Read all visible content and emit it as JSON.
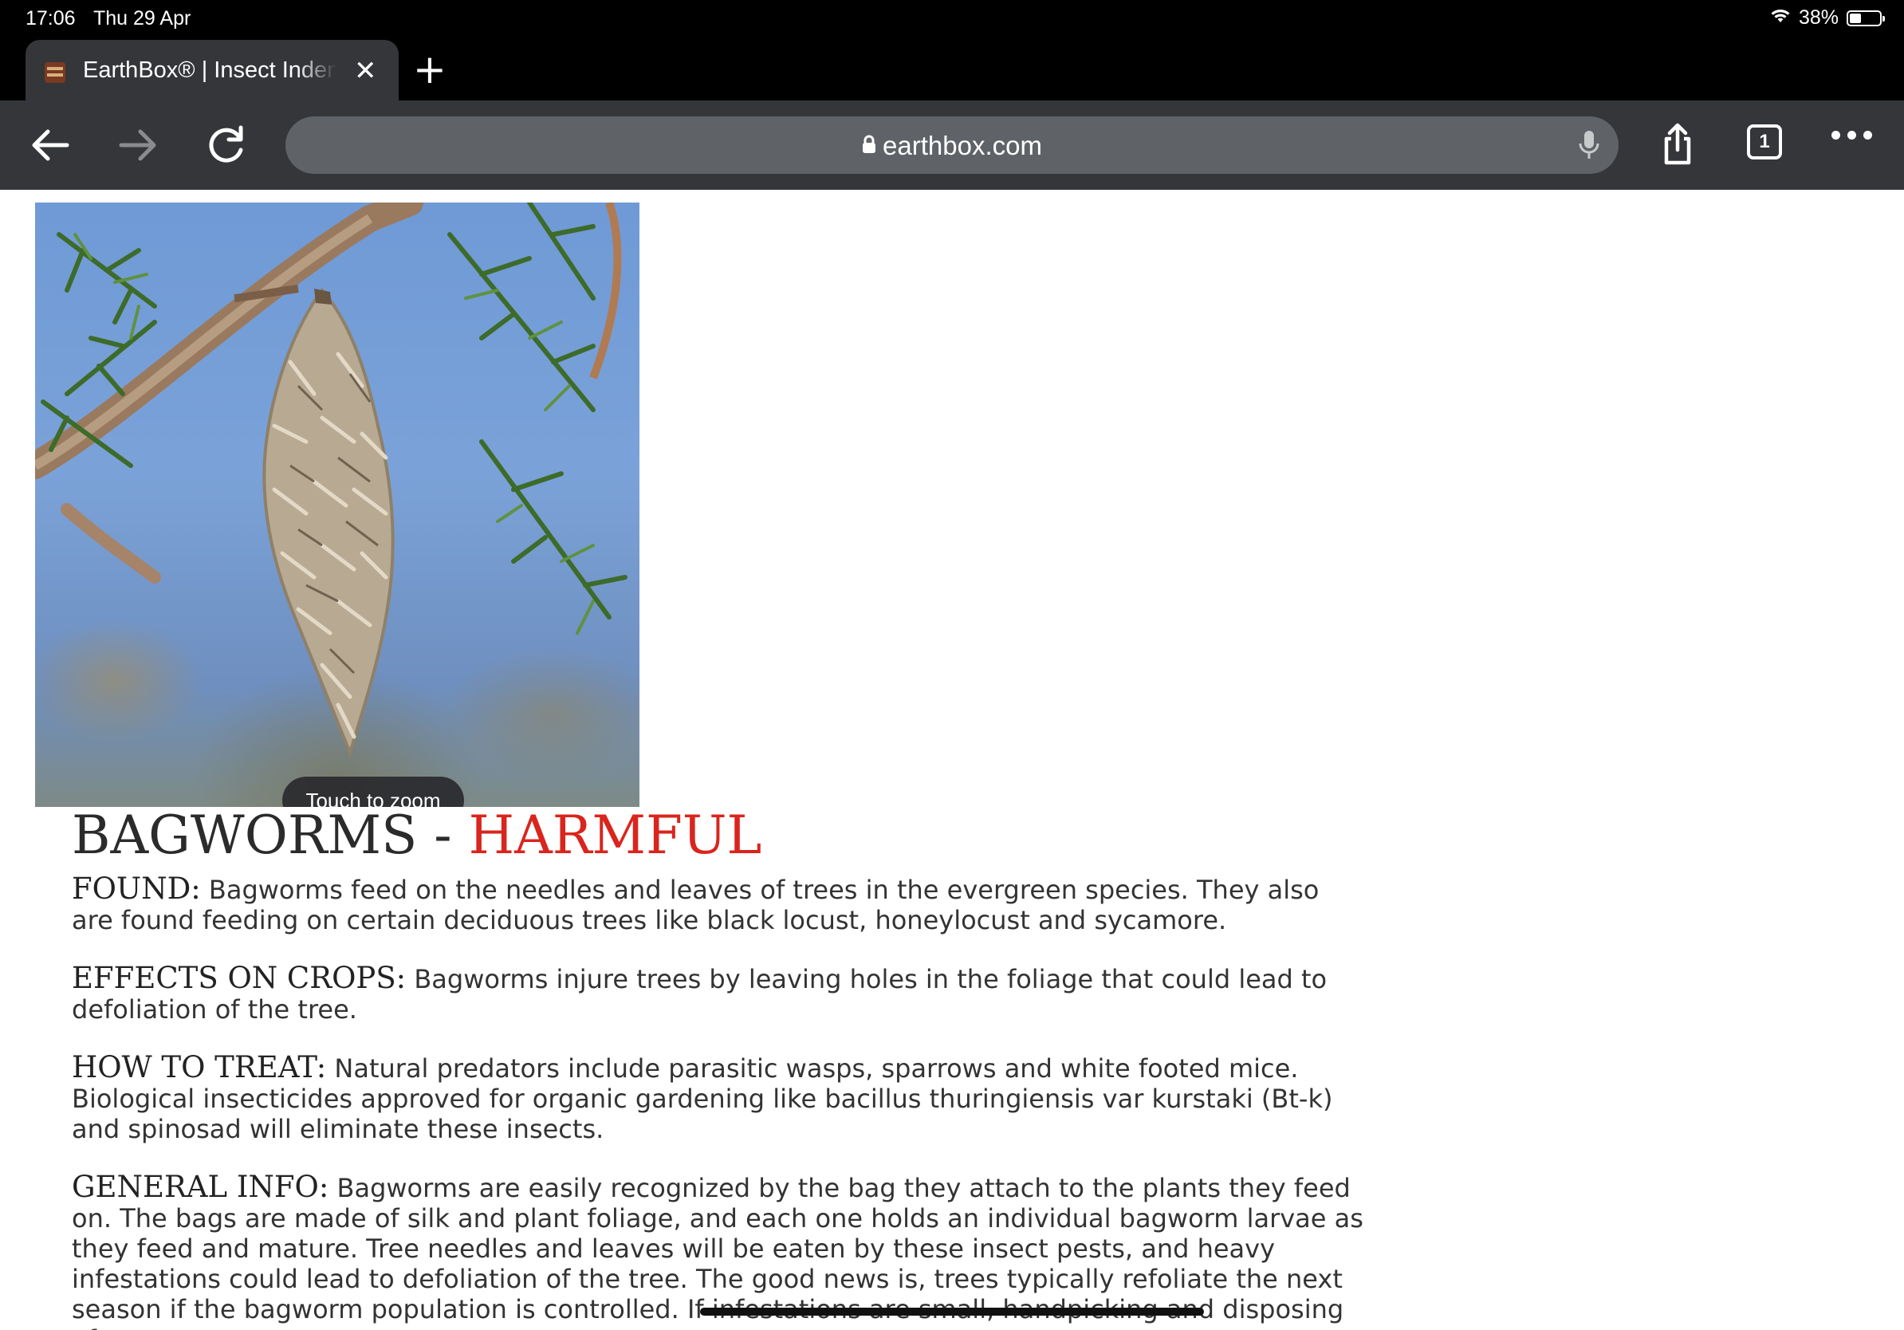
{
  "status_bar": {
    "time": "17:06",
    "date": "Thu 29 Apr",
    "battery_text": "38%",
    "battery_level": 0.38
  },
  "tabs": [
    {
      "title": "EarthBox® | Insect Indentification",
      "favicon": "earthbox-favicon"
    }
  ],
  "toolbar": {
    "url": "earthbox.com",
    "tab_count": "1"
  },
  "image": {
    "subject": "bagworm-photo",
    "zoom_hint": "Touch to zoom"
  },
  "article": {
    "title_main": "BAGWORMS - ",
    "title_status": "HARMFUL",
    "status_color": "#d9251d",
    "sections": [
      {
        "label": "FOUND:",
        "text": "Bagworms feed on the needles and leaves of trees in the evergreen species. They also are found feeding on certain deciduous trees like black locust, honeylocust and sycamore."
      },
      {
        "label": "EFFECTS ON CROPS:",
        "text": "Bagworms injure trees by leaving holes in the foliage that could lead to defoliation of the tree."
      },
      {
        "label": "HOW TO TREAT:",
        "text": "Natural predators include parasitic wasps, sparrows and white footed mice. Biological insecticides approved for organic gardening like bacillus thuringiensis var kurstaki (Bt-k) and spinosad will eliminate these insects."
      },
      {
        "label": "GENERAL INFO:",
        "text": "Bagworms are easily recognized by the bag they attach to the plants they feed on. The bags are made of silk and plant foliage, and each one holds an individual bagworm larvae as they feed and mature. Tree needles and leaves will be eaten by these insect pests, and heavy infestations could lead to defoliation of the tree. The good news is, trees typically refoliate the next season if the bagworm population is controlled. If infestations are small, handpicking and disposing of"
      }
    ]
  },
  "colors": {
    "chrome_dark": "#35363a",
    "omnibox": "#5f6368",
    "accent_red": "#d9251d"
  }
}
